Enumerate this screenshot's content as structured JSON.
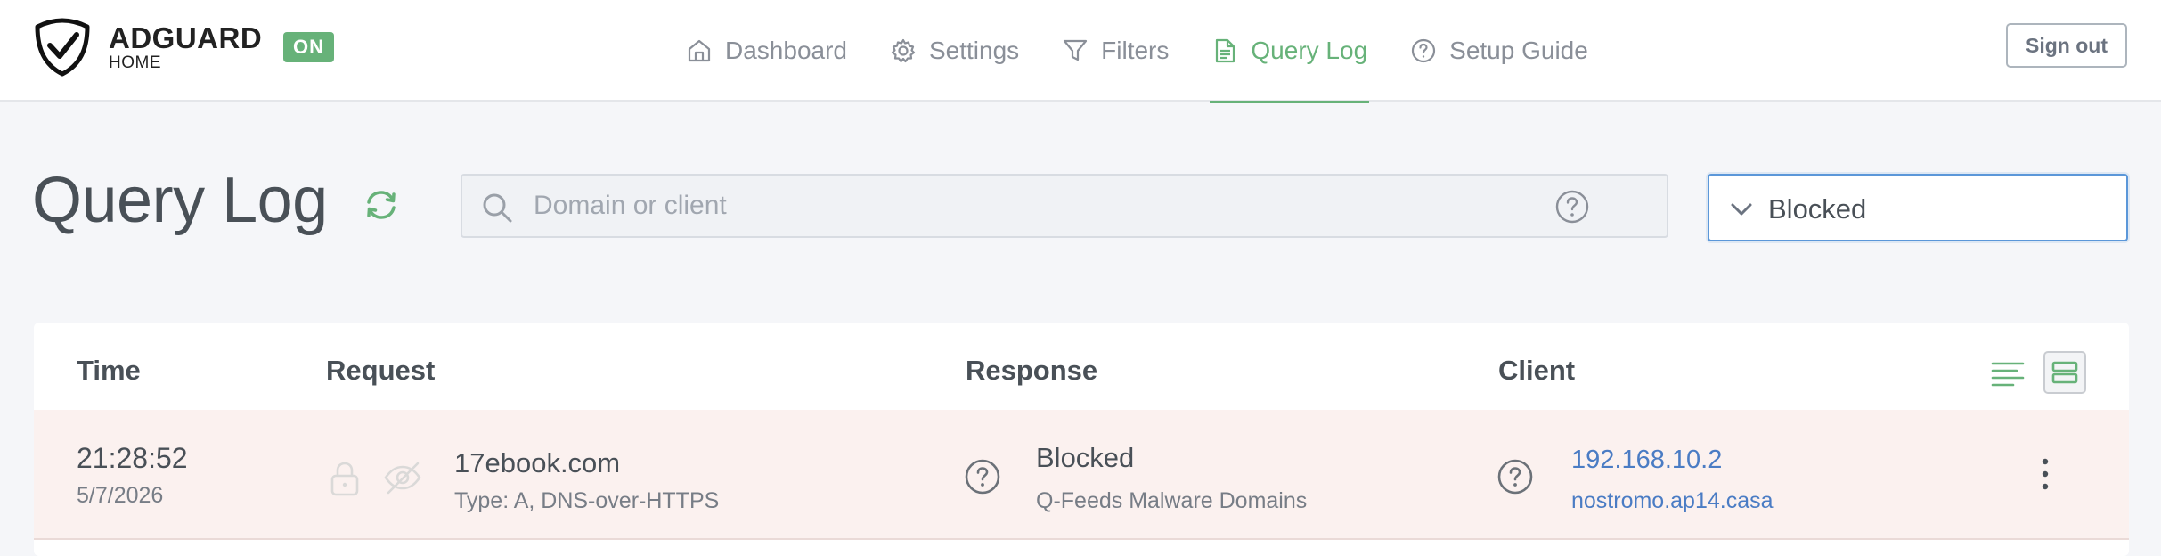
{
  "brand": {
    "name": "ADGUARD",
    "sub": "HOME",
    "status": "ON",
    "status_color": "#67b279"
  },
  "nav": {
    "items": [
      {
        "label": "Dashboard",
        "icon": "home-icon"
      },
      {
        "label": "Settings",
        "icon": "gear-icon"
      },
      {
        "label": "Filters",
        "icon": "filter-icon"
      },
      {
        "label": "Query Log",
        "icon": "document-icon",
        "active": true
      },
      {
        "label": "Setup Guide",
        "icon": "help-circle-icon"
      }
    ],
    "sign_out": "Sign out"
  },
  "page": {
    "title": "Query Log",
    "search_placeholder": "Domain or client",
    "search_value": "",
    "filter_selected": "Blocked"
  },
  "table": {
    "headers": {
      "time": "Time",
      "request": "Request",
      "response": "Response",
      "client": "Client"
    },
    "rows": [
      {
        "time": "21:28:52",
        "date": "5/7/2026",
        "domain": "17ebook.com",
        "type": "Type: A, DNS-over-HTTPS",
        "status": "Blocked",
        "rule": "Q-Feeds Malware Domains",
        "client_ip": "192.168.10.2",
        "client_name": "nostromo.ap14.casa"
      }
    ]
  },
  "colors": {
    "accent": "#67b279",
    "link": "#4a7cc4",
    "blocked_row": "#fbf1ef",
    "focus": "#5b97d9"
  }
}
